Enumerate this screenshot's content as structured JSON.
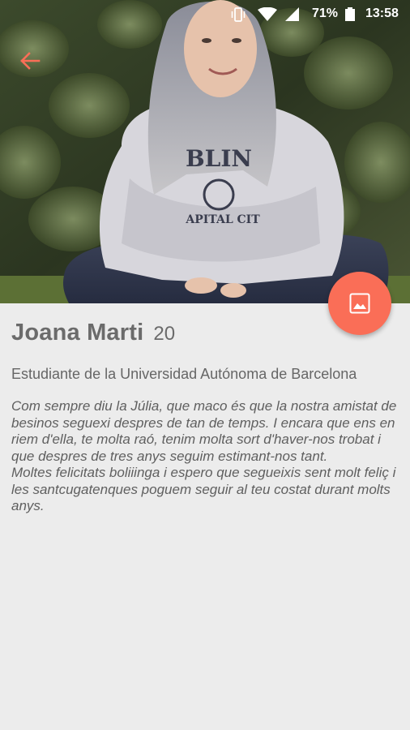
{
  "status_bar": {
    "battery": "71%",
    "time": "13:58"
  },
  "profile": {
    "name": "Joana Marti",
    "age": "20",
    "university": "Estudiante de la Universidad Autónoma de Barcelona",
    "message": "Com sempre diu la Júlia, que maco és que la nostra amistat de besinos seguexi despres de tan de temps. I encara que ens en riem d'ella, te molta raó, tenim molta sort d'haver-nos trobat i que despres de tres anys seguim estimant-nos tant.\nMoltes felicitats boliiinga i espero que segueixis sent molt feliç i les santcugatenques poguem seguir al teu costat durant molts anys."
  },
  "colors": {
    "accent": "#fa6e57",
    "background": "#ececec",
    "text": "#6b6b6b"
  },
  "icons": {
    "back": "arrow-back-icon",
    "fab": "image-icon",
    "vibrate": "vibrate-icon",
    "wifi": "wifi-icon",
    "signal": "signal-icon",
    "battery": "battery-icon"
  }
}
